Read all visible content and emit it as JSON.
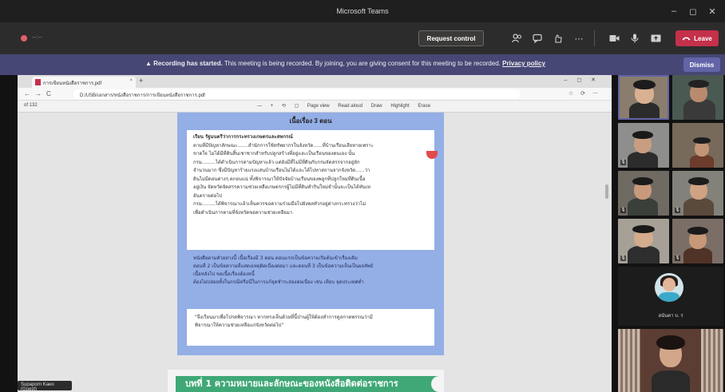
{
  "window": {
    "title": "Microsoft Teams",
    "controls": [
      "–",
      "◻",
      "✕"
    ]
  },
  "meeting_toolbar": {
    "timer": "--:--",
    "request_control": "Request control",
    "leave_label": "Leave",
    "leave_color": "#c4314b"
  },
  "banner": {
    "bold": "Recording has started.",
    "text": " This meeting is being recorded. By joining, you are giving consent for this meeting to be recorded.",
    "link": "Privacy policy",
    "dismiss": "Dismiss",
    "color": "#464775"
  },
  "shared_screen": {
    "tab_title": "การเขียนหนังสือราชการ.pdf",
    "url": "D:/USB/เอกสาร/หนังสือราชการ/การเขียนหนังสือราชการ.pdf",
    "page_indicator": "of 132",
    "tools": [
      "—",
      "+",
      "⟲",
      "▢",
      "Page view",
      "Read aloud",
      "Draw",
      "Highlight",
      "Erase"
    ],
    "page": {
      "heading": "เนื้อเรื่อง 3 ตอน",
      "box1_title": "เรียน รัฐมนตรีว่าการกระทรวงเกษตรและสหกรณ์",
      "box1_lines": [
        "ตามที่มีปัญหาลักษณะ.......สำนักการใช้ทรัพยากรในจังหวัด......ที่บ้านเรือนเสียหายเพราะ",
        "ขาดใจ ไม่ได้มีที่ดินสิ้นเชาชากสำหรับปลูกสร้างที่อยู่และเป็นเรือนของตนเอง นั้น",
        "กรม.........ได้ดำเนินการตามปัญหาแล้ว แต่ยังมีที่ไม่มีที่ดินกับกรมจัดสรรจากอยู่ยัก",
        "จำนวนมาก ซึ่งมีปัญหาร้ายแรงแสนบ้านเรือนไม่ได้และได้ไปหาสถานจากจังหวัด......ว่า",
        "ดินไม่มีตอนต่างๆ ตกอบแน่ ทั้งพิจารณาให้ปัจจัยบ้านเรือนของพลูกที่ปลูกใหม่ที่ดินเนื้อ",
        "อยู่เงิน จัดหวัดจัดสรรความช่วยเหลือเกษตรกรผู้ไม่มีที่ดินทำกินใหม่จำนั้นจะเป็นได้ทันเท",
        "อันตรายต่อไป",
        "กรม.........ได้พิจารณาแล้วเห็นควรขอความร่วมมือไปยังพลทัวรอยู่ต่างกระทรวงว่าไม่",
        "เพื่อดำเนินการตามที่จังหวัดขอความช่วยเหลือมา"
      ],
      "body_lines": [
        "หนังสือตามตัวอย่างนี้ เนื้อเรื่องมี 3 ตอน ตอนแรกเป็นข้อความเริ่มต้นเข้าเรื่องเดิม",
        "ตอนที่ 2 เป็นข้อความที่แสดงเหตุผิดเนื่องต่อมา และตอนที่ 3 เป็นข้อความเห็นเป็นผลลัพธ์",
        "เนื้อหลังไป ขอเนื้อเรื่องต้องหนี้",
        "ต้องไม่ปล่อยทั้งในกรณีหรือนี่ในการแก้จุดชำระสองต่อเนื่อง เช่น เทียบ จุดประเทศต่ำ"
      ],
      "box2_lines": [
        "\"จึงเรียนมาเพื่อโปรดพิจารณา หากทรงเห็นด้วยที่นี้ป่านผู้ให้ต้องทำการดูลกาดพรรณว่ามี",
        "พิจารณาให้ความช่วยเหลือแก่จังหวัดต่อไป\""
      ]
    },
    "chapter_title": "บทที่ 1 ความหมายและลักษณะของหนังสือติดต่อราชการ",
    "presenter_name": "Supaporn Kaeo (Guest)"
  },
  "gallery": {
    "spotlight_label": "อนันดา บ.",
    "pinned_icon": "ร"
  }
}
